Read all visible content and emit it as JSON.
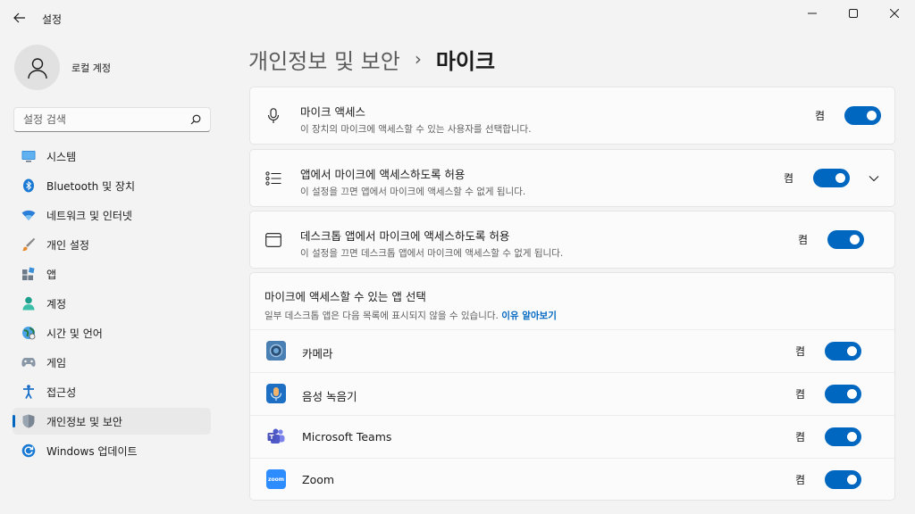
{
  "window": {
    "title": "설정",
    "controls": [
      "minimize-icon",
      "maximize-icon",
      "close-icon"
    ]
  },
  "profile": {
    "name": "로컬 계정"
  },
  "search": {
    "placeholder": "설정 검색"
  },
  "sidebar": {
    "items": [
      {
        "label": "시스템",
        "icon": "system-icon"
      },
      {
        "label": "Bluetooth 및 장치",
        "icon": "bluetooth-icon"
      },
      {
        "label": "네트워크 및 인터넷",
        "icon": "network-icon"
      },
      {
        "label": "개인 설정",
        "icon": "brush-icon"
      },
      {
        "label": "앱",
        "icon": "apps-icon"
      },
      {
        "label": "계정",
        "icon": "account-icon"
      },
      {
        "label": "시간 및 언어",
        "icon": "globe-icon"
      },
      {
        "label": "게임",
        "icon": "gamepad-icon"
      },
      {
        "label": "접근성",
        "icon": "accessibility-icon"
      },
      {
        "label": "개인정보 및 보안",
        "icon": "shield-icon",
        "active": true
      },
      {
        "label": "Windows 업데이트",
        "icon": "update-icon"
      }
    ]
  },
  "header": {
    "parent": "개인정보 및 보안",
    "separator": "›",
    "current": "마이크"
  },
  "settings": [
    {
      "title": "마이크 액세스",
      "subtitle": "이 장치의 마이크에 액세스할 수 있는 사용자를 선택합니다.",
      "state": "켬",
      "on": true,
      "icon": "microphone-icon"
    },
    {
      "title": "앱에서 마이크에 액세스하도록 허용",
      "subtitle": "이 설정을 끄면 앱에서 마이크에 액세스할 수 없게 됩니다.",
      "state": "켬",
      "on": true,
      "icon": "list-icon",
      "expandable": true
    },
    {
      "title": "데스크톱 앱에서 마이크에 액세스하도록 허용",
      "subtitle": "이 설정을 끄면 데스크톱 앱에서 마이크에 액세스할 수 없게 됩니다.",
      "state": "켬",
      "on": true,
      "icon": "window-icon"
    }
  ],
  "app_section": {
    "title": "마이크에 액세스할 수 있는 앱 선택",
    "subtitle": "일부 데스크톱 앱은 다음 목록에 표시되지 않을 수 있습니다.",
    "link": "이유 알아보기",
    "apps": [
      {
        "name": "카메라",
        "state": "켬",
        "on": true,
        "icon": "camera-app-icon"
      },
      {
        "name": "음성 녹음기",
        "state": "켬",
        "on": true,
        "icon": "voice-recorder-icon"
      },
      {
        "name": "Microsoft Teams",
        "state": "켬",
        "on": true,
        "icon": "teams-icon"
      },
      {
        "name": "Zoom",
        "state": "켬",
        "on": true,
        "icon": "zoom-icon",
        "logo_text": "zoom"
      }
    ]
  },
  "colors": {
    "accent": "#0067c0",
    "background": "#f3f3f3",
    "card": "#fbfbfb"
  }
}
